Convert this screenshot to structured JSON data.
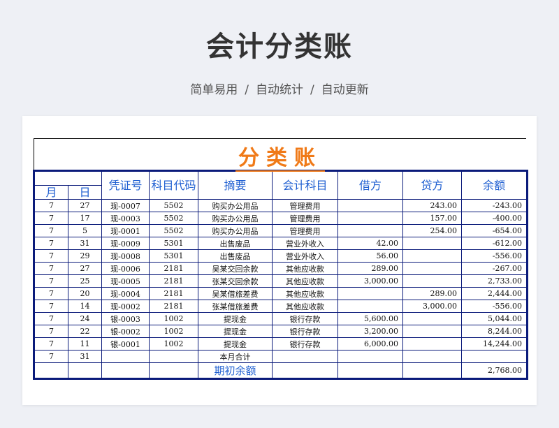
{
  "page": {
    "title": "会计分类账",
    "subtitle_parts": [
      "简单易用",
      "自动统计",
      "自动更新"
    ],
    "separator": "/"
  },
  "sheet": {
    "title": "分类账",
    "headers": {
      "month": "月",
      "day": "日",
      "voucher": "凭证号",
      "account_code": "科目代码",
      "summary": "摘要",
      "account": "会计科目",
      "debit": "借方",
      "credit": "贷方",
      "balance": "余额"
    },
    "rows": [
      {
        "month": "7",
        "day": "27",
        "voucher": "现-0007",
        "code": "5502",
        "summary": "购买办公用品",
        "account": "管理费用",
        "debit": "",
        "credit": "243.00",
        "balance": "-243.00"
      },
      {
        "month": "7",
        "day": "17",
        "voucher": "现-0003",
        "code": "5502",
        "summary": "购买办公用品",
        "account": "管理费用",
        "debit": "",
        "credit": "157.00",
        "balance": "-400.00"
      },
      {
        "month": "7",
        "day": "5",
        "voucher": "现-0001",
        "code": "5502",
        "summary": "购买办公用品",
        "account": "管理费用",
        "debit": "",
        "credit": "254.00",
        "balance": "-654.00"
      },
      {
        "month": "7",
        "day": "31",
        "voucher": "现-0009",
        "code": "5301",
        "summary": "出售废品",
        "account": "营业外收入",
        "debit": "42.00",
        "credit": "",
        "balance": "-612.00"
      },
      {
        "month": "7",
        "day": "29",
        "voucher": "现-0008",
        "code": "5301",
        "summary": "出售废品",
        "account": "营业外收入",
        "debit": "56.00",
        "credit": "",
        "balance": "-556.00"
      },
      {
        "month": "7",
        "day": "27",
        "voucher": "现-0006",
        "code": "2181",
        "summary": "吴某交回余款",
        "account": "其他应收款",
        "debit": "289.00",
        "credit": "",
        "balance": "-267.00"
      },
      {
        "month": "7",
        "day": "25",
        "voucher": "现-0005",
        "code": "2181",
        "summary": "张某交回余款",
        "account": "其他应收款",
        "debit": "3,000.00",
        "credit": "",
        "balance": "2,733.00"
      },
      {
        "month": "7",
        "day": "20",
        "voucher": "现-0004",
        "code": "2181",
        "summary": "吴某借旅差费",
        "account": "其他应收款",
        "debit": "",
        "credit": "289.00",
        "balance": "2,444.00"
      },
      {
        "month": "7",
        "day": "14",
        "voucher": "现-0002",
        "code": "2181",
        "summary": "张某借旅差费",
        "account": "其他应收款",
        "debit": "",
        "credit": "3,000.00",
        "balance": "-556.00"
      },
      {
        "month": "7",
        "day": "24",
        "voucher": "银-0003",
        "code": "1002",
        "summary": "提现金",
        "account": "银行存款",
        "debit": "5,600.00",
        "credit": "",
        "balance": "5,044.00"
      },
      {
        "month": "7",
        "day": "22",
        "voucher": "银-0002",
        "code": "1002",
        "summary": "提现金",
        "account": "银行存款",
        "debit": "3,200.00",
        "credit": "",
        "balance": "8,244.00"
      },
      {
        "month": "7",
        "day": "11",
        "voucher": "银-0001",
        "code": "1002",
        "summary": "提现金",
        "account": "银行存款",
        "debit": "6,000.00",
        "credit": "",
        "balance": "14,244.00"
      }
    ],
    "month_total": {
      "month": "7",
      "day": "31",
      "label": "本月合计"
    },
    "opening_balance": {
      "label": "期初余额",
      "value": "2,768.00"
    }
  }
}
